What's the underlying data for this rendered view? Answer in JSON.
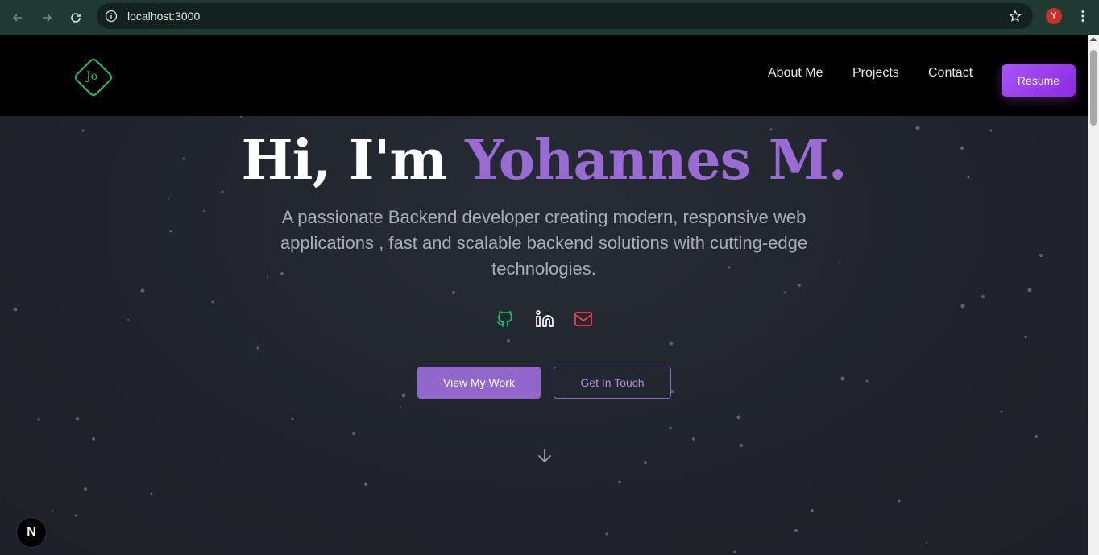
{
  "browser": {
    "url": "localhost:3000",
    "profile_initial": "Y",
    "icons": [
      "back-icon",
      "forward-icon",
      "reload-icon",
      "info-icon",
      "star-icon",
      "kebab-icon"
    ]
  },
  "header": {
    "logo_text": "Jo",
    "nav": [
      "About Me",
      "Projects",
      "Contact"
    ],
    "resume_label": "Resume"
  },
  "hero": {
    "greeting": "Hi, I'm ",
    "name": "Yohannes M.",
    "subtitle": "A passionate Backend developer creating modern, responsive web applications , fast and scalable backend solutions with cutting-edge technologies.",
    "social_icons": [
      "github-icon",
      "linkedin-icon",
      "mail-icon"
    ],
    "primary_cta": "View My Work",
    "secondary_cta": "Get In Touch"
  },
  "dev_badge": "N",
  "colors": {
    "accent": "#9b6bd4",
    "logo": "#22c55e",
    "resume_from": "#a855f7",
    "resume_to": "#8b2be2",
    "github": "#22c55e",
    "mail": "#ef4444"
  }
}
